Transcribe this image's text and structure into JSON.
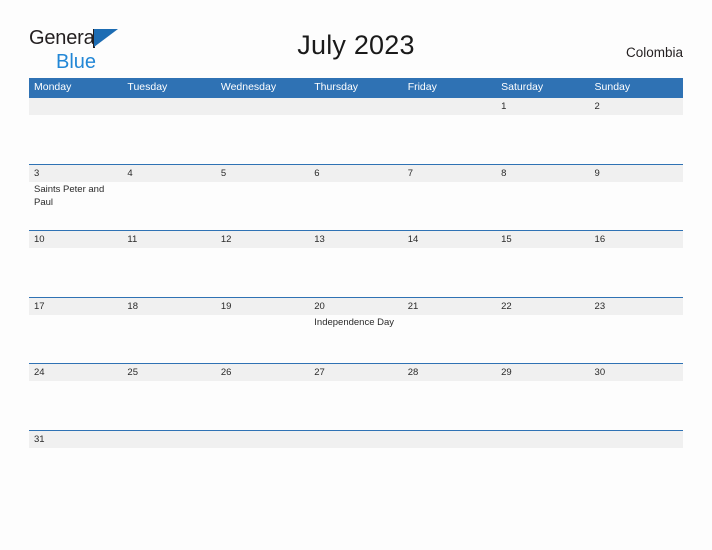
{
  "brand": {
    "line1": "General",
    "line2": "Blue",
    "flag_color": "#1c6cb3",
    "text_color": "#231f20",
    "blue_text_color": "#2287d6"
  },
  "header": {
    "title": "July 2023",
    "country": "Colombia"
  },
  "theme": {
    "header_blue": "#2f72b4",
    "number_band": "#f0f0f0",
    "page_background": "#fdfdfd",
    "grid_line": "#2f72b4"
  },
  "calendar": {
    "month": "July",
    "year": "2023",
    "weekday_headers": [
      "Monday",
      "Tuesday",
      "Wednesday",
      "Thursday",
      "Friday",
      "Saturday",
      "Sunday"
    ],
    "weeks": [
      {
        "days": [
          {
            "number": "",
            "event": ""
          },
          {
            "number": "",
            "event": ""
          },
          {
            "number": "",
            "event": ""
          },
          {
            "number": "",
            "event": ""
          },
          {
            "number": "",
            "event": ""
          },
          {
            "number": "1",
            "event": ""
          },
          {
            "number": "2",
            "event": ""
          }
        ]
      },
      {
        "days": [
          {
            "number": "3",
            "event": "Saints Peter and Paul"
          },
          {
            "number": "4",
            "event": ""
          },
          {
            "number": "5",
            "event": ""
          },
          {
            "number": "6",
            "event": ""
          },
          {
            "number": "7",
            "event": ""
          },
          {
            "number": "8",
            "event": ""
          },
          {
            "number": "9",
            "event": ""
          }
        ]
      },
      {
        "days": [
          {
            "number": "10",
            "event": ""
          },
          {
            "number": "11",
            "event": ""
          },
          {
            "number": "12",
            "event": ""
          },
          {
            "number": "13",
            "event": ""
          },
          {
            "number": "14",
            "event": ""
          },
          {
            "number": "15",
            "event": ""
          },
          {
            "number": "16",
            "event": ""
          }
        ]
      },
      {
        "days": [
          {
            "number": "17",
            "event": ""
          },
          {
            "number": "18",
            "event": ""
          },
          {
            "number": "19",
            "event": ""
          },
          {
            "number": "20",
            "event": "Independence Day"
          },
          {
            "number": "21",
            "event": ""
          },
          {
            "number": "22",
            "event": ""
          },
          {
            "number": "23",
            "event": ""
          }
        ]
      },
      {
        "days": [
          {
            "number": "24",
            "event": ""
          },
          {
            "number": "25",
            "event": ""
          },
          {
            "number": "26",
            "event": ""
          },
          {
            "number": "27",
            "event": ""
          },
          {
            "number": "28",
            "event": ""
          },
          {
            "number": "29",
            "event": ""
          },
          {
            "number": "30",
            "event": ""
          }
        ]
      },
      {
        "last": true,
        "days": [
          {
            "number": "31",
            "event": ""
          },
          {
            "number": "",
            "event": ""
          },
          {
            "number": "",
            "event": ""
          },
          {
            "number": "",
            "event": ""
          },
          {
            "number": "",
            "event": ""
          },
          {
            "number": "",
            "event": ""
          },
          {
            "number": "",
            "event": ""
          }
        ]
      }
    ]
  }
}
